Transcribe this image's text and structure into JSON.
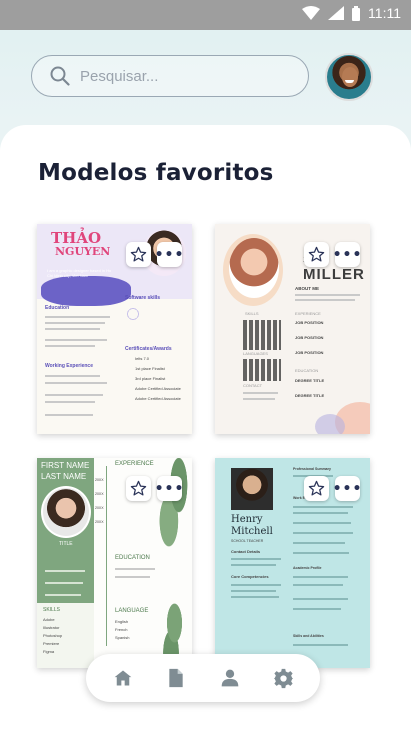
{
  "status_bar": {
    "time": "11:11"
  },
  "search": {
    "placeholder": "Pesquisar..."
  },
  "favorites": {
    "title": "Modelos favoritos",
    "templates": [
      {
        "name_line1": "THẢO",
        "name_line2": "NGUYEN",
        "sections": [
          "Education",
          "Working Experience",
          "Software skills",
          "Certificates/Awards"
        ],
        "tagline": "I am a graphic designer based in Ho Chi Minh city, Viet Nam",
        "certificates": [
          "Ielts 7.0",
          "1st place Finalist",
          "3rd place Finalist",
          "Adobe Certified Associate",
          "Adobe Certified Associate"
        ]
      },
      {
        "name_line1": "S E",
        "name_line2": "MILLER",
        "sections": [
          "ABOUT ME",
          "SKILLS",
          "EXPERIENCE",
          "LANGUAGES",
          "EDUCATION",
          "CONTACT"
        ],
        "job": "JOB POSITION",
        "degree": "DEGREE TITLE"
      },
      {
        "name_line1": "FIRST NAME",
        "name_line2": "LAST NAME",
        "title": "TITLE",
        "sections": [
          "EXPERIENCE",
          "EDUCATION",
          "LANGUAGE",
          "SKILLS"
        ],
        "years": [
          "20XX",
          "20XX",
          "20XX",
          "20XX"
        ],
        "languages": [
          "English",
          "French",
          "Spanish"
        ],
        "skills": [
          "Adobe",
          "Illustrator",
          "Photoshop",
          "Premiere",
          "Figma"
        ]
      },
      {
        "name_line1": "Henry",
        "name_line2": "Mitchell",
        "role": "SCHOOL TEACHER",
        "sections": [
          "Professional Summary",
          "Work Experience",
          "Contact Details",
          "Core Competencies",
          "Academic Profile",
          "Skills and Abilities"
        ]
      }
    ]
  },
  "nav": {
    "items": [
      "home-icon",
      "document-icon",
      "profile-icon",
      "settings-icon"
    ]
  }
}
